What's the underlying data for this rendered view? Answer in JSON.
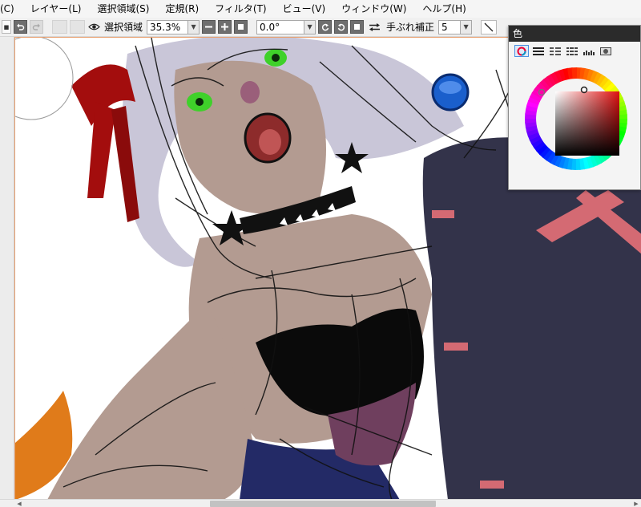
{
  "menu": {
    "items": [
      {
        "label": "(C)"
      },
      {
        "label": "レイヤー(L)"
      },
      {
        "label": "選択領域(S)"
      },
      {
        "label": "定規(R)"
      },
      {
        "label": "フィルタ(T)"
      },
      {
        "label": "ビュー(V)"
      },
      {
        "label": "ウィンドウ(W)"
      },
      {
        "label": "ヘルプ(H)"
      }
    ]
  },
  "toolbar": {
    "selection_label": "選択領域",
    "zoom_value": "35.3%",
    "rotation_value": "0.0°",
    "stabilizer_label": "手ぶれ補正",
    "stabilizer_value": "5"
  },
  "color_panel": {
    "title": "色",
    "tabs": [
      {
        "icon": "color-wheel-icon",
        "active": true
      },
      {
        "icon": "rgb-sliders-icon",
        "active": false
      },
      {
        "icon": "hsv-sliders-icon",
        "active": false
      },
      {
        "icon": "palette-list-icon",
        "active": false
      },
      {
        "icon": "swatch-grid-icon",
        "active": false
      },
      {
        "icon": "scratchpad-icon",
        "active": false
      }
    ],
    "selected_color": "#6b0000"
  },
  "colors": {
    "menubar_bg": "#f5f5f5",
    "panel_title_bg": "#2b2b2b",
    "canvas_border": "#e8a070",
    "hair": "#c9c6d8",
    "skin": "#b39b91",
    "dress": "#33334a",
    "ribbon": "#a30d0d",
    "eye": "#3fd12a",
    "blue_accent": "#1a5fcc",
    "pink_accent": "#d46a73",
    "orange_accent": "#e07b1a"
  }
}
